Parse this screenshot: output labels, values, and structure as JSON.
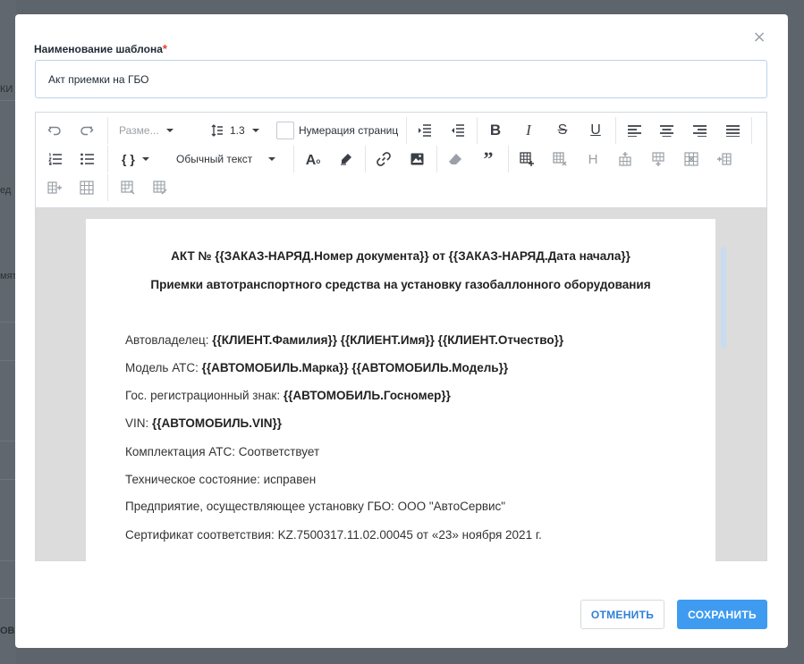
{
  "modal": {
    "close_glyph": "×",
    "name_label": "Наименование шаблона",
    "required_mark": "*",
    "name_value": "Акт приемки на ГБО"
  },
  "background": {
    "fragments": [
      "КИ",
      "ед",
      "мят",
      "ОВ"
    ]
  },
  "toolbar": {
    "font_size_label": "Разме...",
    "line_height_label": "1.3",
    "page_numbering_label": "Нумерация страниц",
    "bold": "B",
    "italic": "I",
    "strike": "S",
    "underline": "U",
    "template_vars": "{ }",
    "paragraph_style": "Обычный текст",
    "font_color": "A",
    "quote": "”",
    "heading": "H",
    "icons": [
      "undo-icon",
      "redo-icon",
      "line-height-icon",
      "indent-decrease-icon",
      "indent-increase-icon",
      "bold-icon",
      "italic-icon",
      "strikethrough-icon",
      "underline-icon",
      "align-left-icon",
      "align-center-icon",
      "align-right-icon",
      "align-justify-icon",
      "ordered-list-icon",
      "bullet-list-icon",
      "braces-icon",
      "font-color-icon",
      "highlight-icon",
      "link-icon",
      "image-icon",
      "eraser-icon",
      "quote-icon",
      "table-insert-icon",
      "table-delete-icon",
      "heading-icon",
      "table-row-above-icon",
      "table-row-below-icon",
      "table-row-delete-icon",
      "table-col-before-icon",
      "table-col-after-icon",
      "table-col-delete-icon",
      "table-merge-icon",
      "table-props-icon"
    ]
  },
  "document": {
    "title_line1": "АКТ № {{ЗАКАЗ-НАРЯД.Номер документа}} от {{ЗАКАЗ-НАРЯД.Дата начала}}",
    "title_line2": "Приемки автотранспортного средства на установку газобаллонного оборудования",
    "lines": [
      {
        "label": "Автовладелец: ",
        "value": "{{КЛИЕНТ.Фамилия}} {{КЛИЕНТ.Имя}} {{КЛИЕНТ.Отчество}}"
      },
      {
        "label": "Модель АТС: ",
        "value": "{{АВТОМОБИЛЬ.Марка}} {{АВТОМОБИЛЬ.Модель}}"
      },
      {
        "label": "Гос. регистрационный знак: ",
        "value": "{{АВТОМОБИЛЬ.Госномер}}"
      },
      {
        "label": "VIN: ",
        "value": "{{АВТОМОБИЛЬ.VIN}}"
      },
      {
        "label": "Комплектация АТС: Соответствует",
        "value": ""
      },
      {
        "label": "Техническое состояние: исправен",
        "value": ""
      },
      {
        "label": "Предприятие, осуществляющее установку ГБО: ООО \"АвтоСервис\"",
        "value": ""
      },
      {
        "label": "Сертификат соответствия: KZ.7500317.11.02.00045 от «23» ноября 2021 г.",
        "value": ""
      }
    ]
  },
  "buttons": {
    "cancel": "ОТМЕНИТЬ",
    "save": "СОХРАНИТЬ"
  },
  "colors": {
    "accent": "#3f9bf0",
    "required": "#e53935",
    "overlay": "#5f6770"
  }
}
